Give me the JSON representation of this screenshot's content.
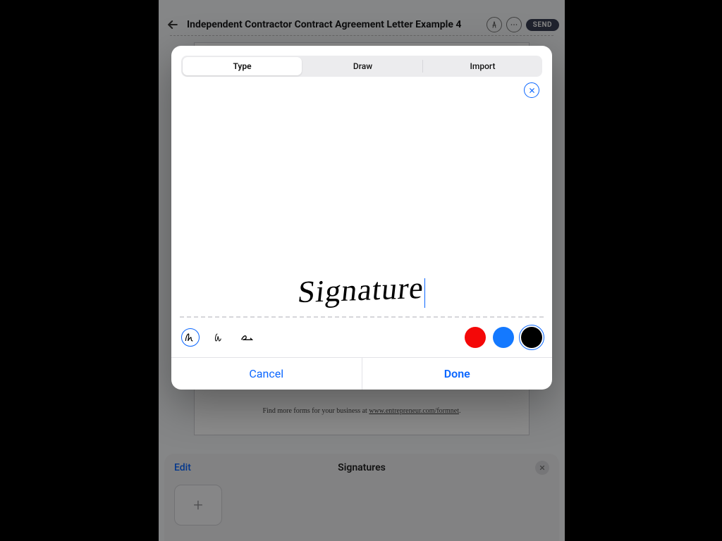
{
  "header": {
    "title": "Independent Contractor Contract Agreement Letter Example 4",
    "send_label": "SEND"
  },
  "document": {
    "footer_prefix": "Find more forms for your business at ",
    "footer_link": "www.entrepreneur.com/formnet"
  },
  "sheet": {
    "edit_label": "Edit",
    "title": "Signatures",
    "add_label": "+"
  },
  "modal": {
    "tabs": {
      "type": "Type",
      "draw": "Draw",
      "import": "Import",
      "active": "type"
    },
    "signature_text": "Signature",
    "style_options": [
      "style-1",
      "style-2",
      "style-3"
    ],
    "selected_style": "style-1",
    "colors": {
      "red": "#f40808",
      "blue": "#1479ff",
      "black": "#000000",
      "selected": "black"
    },
    "cancel_label": "Cancel",
    "done_label": "Done"
  }
}
